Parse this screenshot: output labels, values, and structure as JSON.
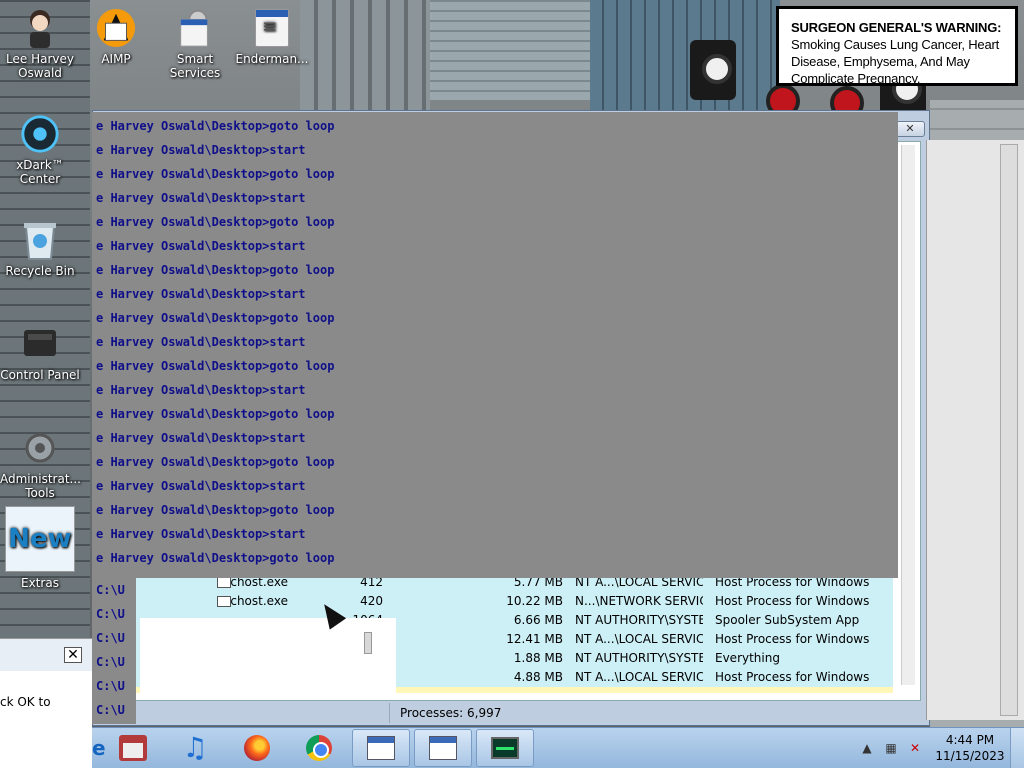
{
  "desktop": {
    "icons": [
      {
        "label": "Lee Harvey\nOswald",
        "label1": "Lee Harvey",
        "label2": "Oswald",
        "icon": "person-icon"
      },
      {
        "label1": "AIMP",
        "label2": "",
        "icon": "app-icon"
      },
      {
        "label1": "Smart",
        "label2": "Services",
        "icon": "gear-app-icon"
      },
      {
        "label1": "Enderman...",
        "label2": "",
        "icon": "app-icon"
      },
      {
        "label1": "xDark™",
        "label2": "Center",
        "icon": "xdark-icon"
      },
      {
        "label1": "Recycle Bin",
        "label2": "",
        "icon": "recycle-bin-icon"
      },
      {
        "label1": "Control Panel",
        "label2": "",
        "icon": "control-panel-icon"
      },
      {
        "label1": "Administrat...",
        "label2": "Tools",
        "icon": "admin-tools-icon"
      },
      {
        "label1": "Extras",
        "label2": "",
        "icon": "extras-icon"
      }
    ]
  },
  "warning": {
    "bold": "SURGEON GENERAL'S WARNING:",
    "text": " Smoking Causes Lung Cancer, Heart Disease, Emphysema, And May Complicate Pregnancy."
  },
  "console": {
    "lines": [
      "e Harvey Oswald\\Desktop>goto loop",
      "e Harvey Oswald\\Desktop>start",
      "e Harvey Oswald\\Desktop>goto loop",
      "e Harvey Oswald\\Desktop>start",
      "e Harvey Oswald\\Desktop>goto loop",
      "e Harvey Oswald\\Desktop>start",
      "e Harvey Oswald\\Desktop>goto loop",
      "e Harvey Oswald\\Desktop>start",
      "e Harvey Oswald\\Desktop>goto loop",
      "e Harvey Oswald\\Desktop>start",
      "e Harvey Oswald\\Desktop>goto loop",
      "e Harvey Oswald\\Desktop>start",
      "e Harvey Oswald\\Desktop>goto loop",
      "e Harvey Oswald\\Desktop>start",
      "e Harvey Oswald\\Desktop>goto loop",
      "e Harvey Oswald\\Desktop>start",
      "e Harvey Oswald\\Desktop>goto loop",
      "e Harvey Oswald\\Desktop>start",
      "e Harvey Oswald\\Desktop>goto loop"
    ],
    "strip_lines": [
      "C:\\U",
      "C:\\U",
      "C:\\U",
      "C:\\U",
      "C:\\U",
      "C:\\U"
    ]
  },
  "task_manager": {
    "controls": [
      "—",
      "□",
      "✕"
    ],
    "rows": [
      {
        "image": "svchost.exe",
        "pid": "412",
        "mem": "5.77 MB",
        "user": "NT A...\\LOCAL SERVICE",
        "desc": "Host Process for Windows Ser..."
      },
      {
        "image": "svchost.exe",
        "pid": "420",
        "mem": "10.22 MB",
        "user": "N...\\NETWORK SERVICE",
        "desc": "Host Process for Windows Ser..."
      },
      {
        "image": "",
        "pid": "1064",
        "mem": "6.66 MB",
        "user": "NT AUTHORITY\\SYSTEM",
        "desc": "Spooler SubSystem App"
      },
      {
        "image": "",
        "pid": "",
        "mem": "12.41 MB",
        "user": "NT A...\\LOCAL SERVICE",
        "desc": "Host Process for Windows Ser..."
      },
      {
        "image": "",
        "pid": "",
        "mem": "1.88 MB",
        "user": "NT AUTHORITY\\SYSTEM",
        "desc": "Everything"
      },
      {
        "image": "",
        "pid": "",
        "mem": "4.88 MB",
        "user": "NT A...\\LOCAL SERVICE",
        "desc": "Host Process for Windows Ser..."
      }
    ],
    "status": "Processes: 6,997"
  },
  "dialog": {
    "close": "✕",
    "message": "ck OK to"
  },
  "taskbar": {
    "items": [
      "store-icon",
      "music-icon",
      "firefox-icon",
      "chrome-icon",
      "window-app-icon",
      "task-manager-icon",
      "monitor-icon"
    ],
    "time": "4:44 PM",
    "date": "11/15/2023"
  }
}
